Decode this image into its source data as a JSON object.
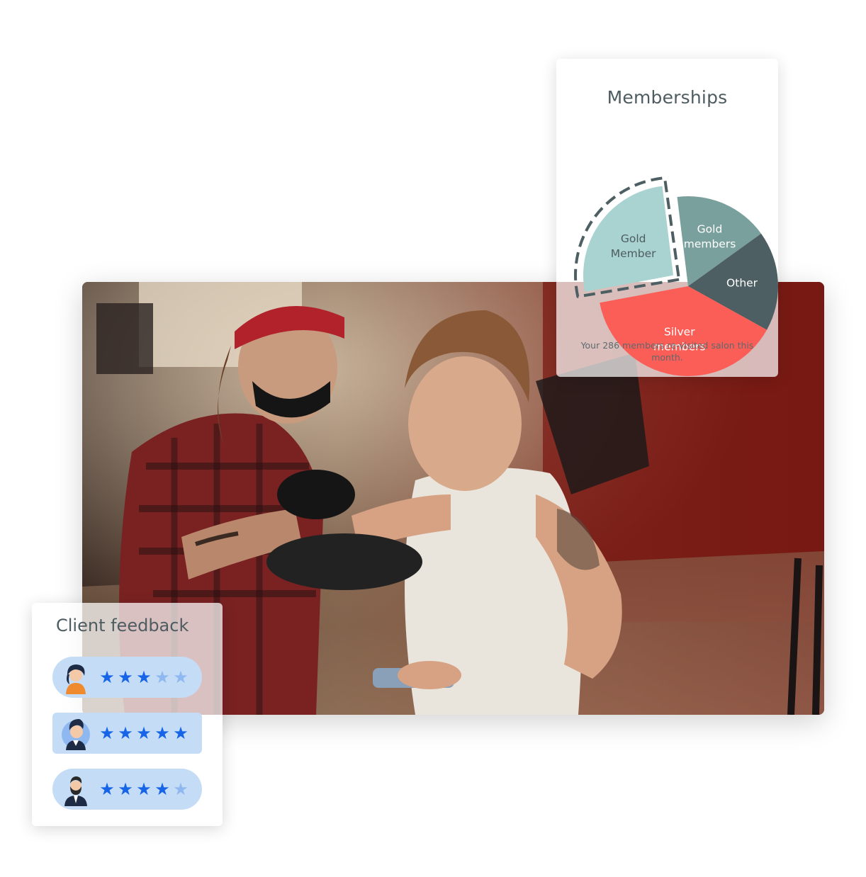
{
  "colors": {
    "teal_light": "#a9d3d0",
    "teal": "#7aa09e",
    "slate": "#4d5f62",
    "coral": "#fa5e56",
    "star_on": "#1665e8",
    "star_off": "#8fb8f0",
    "row_bg": "#c4dcf6",
    "title_text": "#4e5c61"
  },
  "memberships": {
    "title": "Memberships",
    "caption": "Your 286 members re-visited salon this month."
  },
  "chart_data": {
    "type": "pie",
    "title": "Memberships",
    "slices": [
      {
        "label": "Gold members",
        "label_lines": [
          "Gold",
          "members"
        ],
        "value": 17,
        "color": "#7aa09e",
        "exploded": false
      },
      {
        "label": "Other",
        "label_lines": [
          "Other"
        ],
        "value": 18,
        "color": "#4d5f62",
        "exploded": false
      },
      {
        "label": "Silver members",
        "label_lines": [
          "Silver",
          "members"
        ],
        "value": 39,
        "color": "#fa5e56",
        "exploded": false
      },
      {
        "label": "Gold Member",
        "label_lines": [
          "Gold",
          "Member"
        ],
        "value": 26,
        "color": "#a9d3d0",
        "exploded": true
      }
    ],
    "highlighted": "Gold Member"
  },
  "feedback": {
    "title": "Client feedback",
    "reviews": [
      {
        "avatar": "woman-avatar-icon",
        "rating": 3,
        "max": 5
      },
      {
        "avatar": "man-avatar-icon",
        "rating": 5,
        "max": 5
      },
      {
        "avatar": "bearded-man-avatar-icon",
        "rating": 4,
        "max": 5
      }
    ]
  },
  "icons": {
    "star": "★"
  }
}
